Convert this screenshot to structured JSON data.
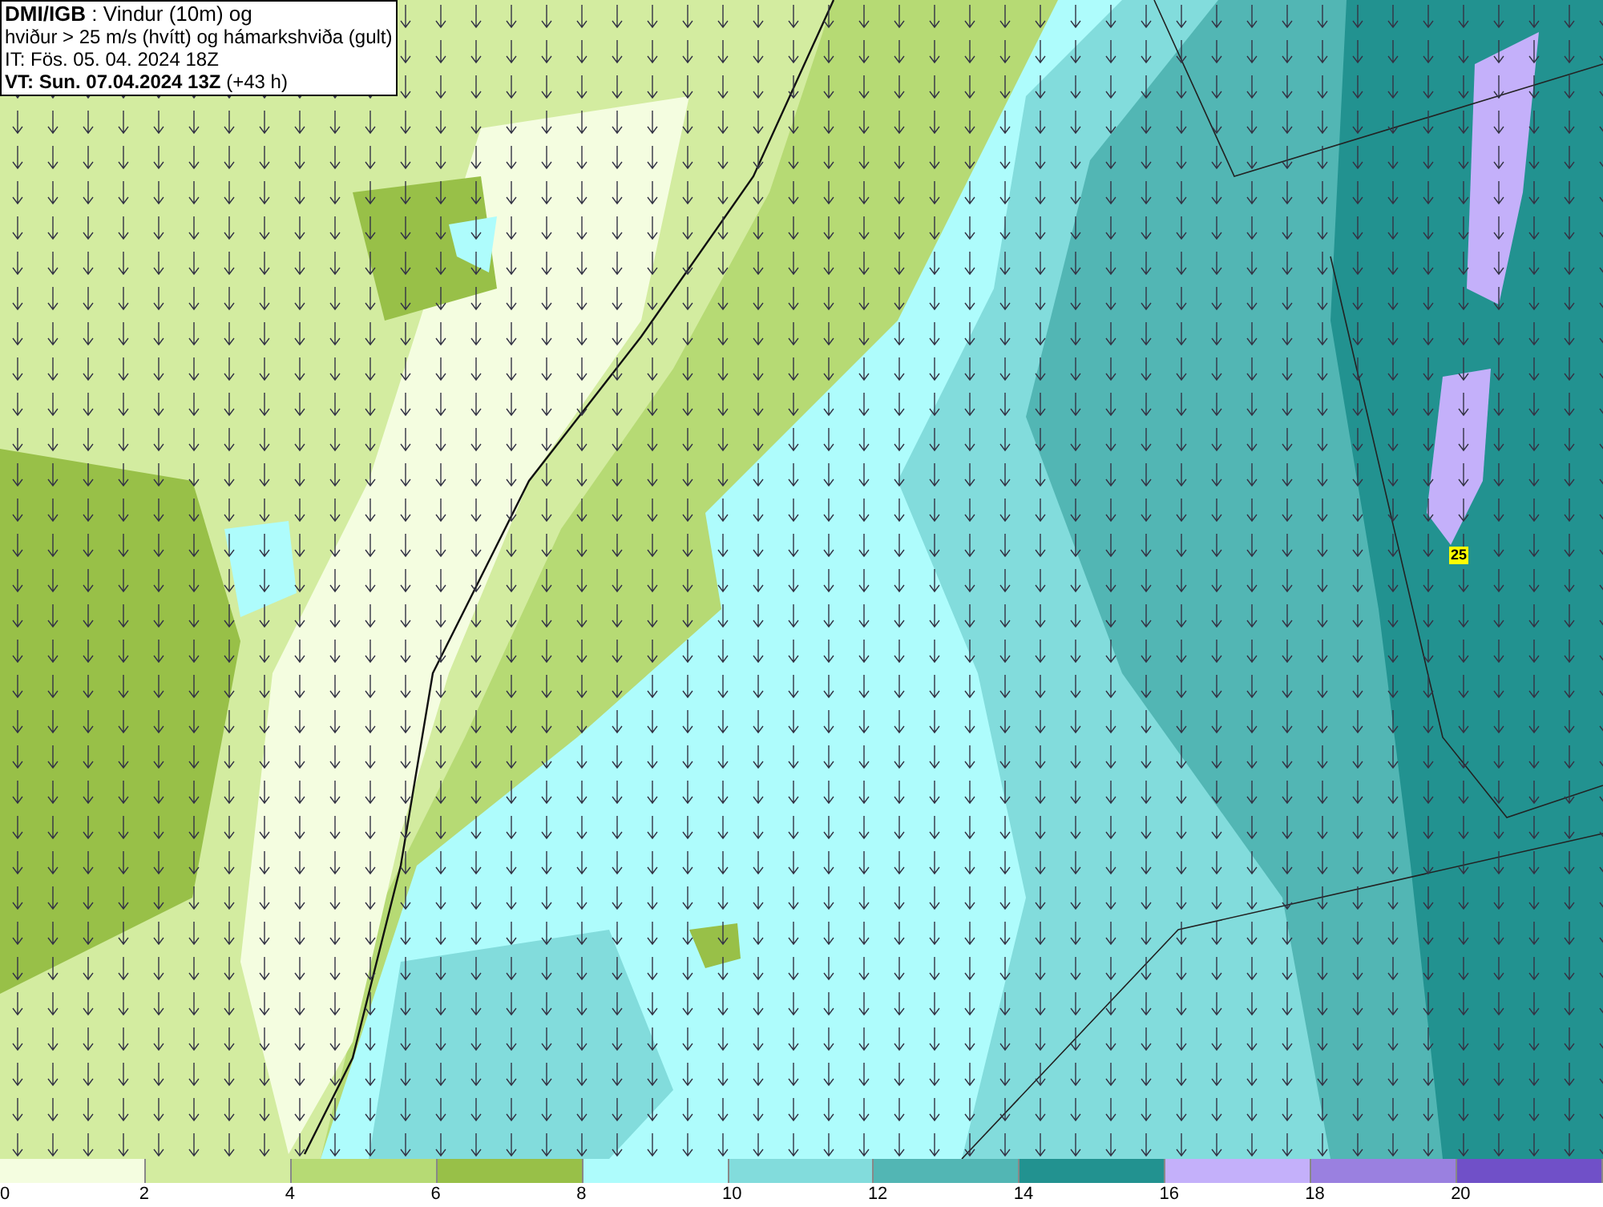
{
  "title_box": {
    "lines": [
      "**DMI/IGB** : Vindur (10m) og",
      "hviður > 25 m/s (hvítt) og hámarkshviða (gult)",
      "IT: Fös. 05. 04. 2024 18Z",
      "**VT: Sun. 07.04.2024 13Z** (+43 h)"
    ]
  },
  "gust_labels": [
    {
      "text": "25"
    }
  ],
  "legend": [
    {
      "label": "0",
      "color": "#f4fde0"
    },
    {
      "label": "2",
      "color": "#d3eca0"
    },
    {
      "label": "4",
      "color": "#b6da74"
    },
    {
      "label": "6",
      "color": "#98c048"
    },
    {
      "label": "8",
      "color": "#aefcfc"
    },
    {
      "label": "10",
      "color": "#82dcdc"
    },
    {
      "label": "12",
      "color": "#52b6b4"
    },
    {
      "label": "14",
      "color": "#229290"
    },
    {
      "label": "16",
      "color": "#c4b0fa"
    },
    {
      "label": "18",
      "color": "#9a80e0"
    },
    {
      "label": "20",
      "color": "#7050c8"
    }
  ]
}
